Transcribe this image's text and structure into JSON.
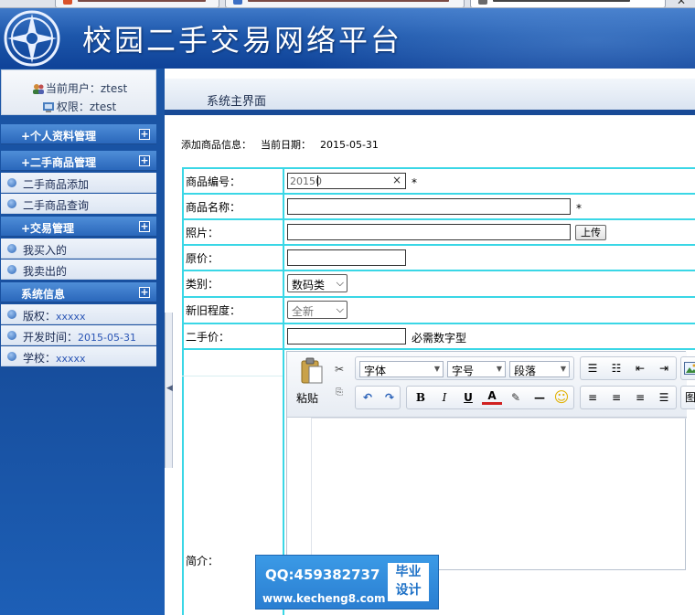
{
  "banner": {
    "title": "校园二手交易网络平台"
  },
  "user": {
    "current_user": "当前用户：ztest",
    "role": "权限：ztest"
  },
  "sidebar": {
    "groups": [
      {
        "label": "+个人资料管理",
        "items": []
      },
      {
        "label": "+二手商品管理",
        "items": [
          "二手商品添加",
          "二手商品查询"
        ]
      },
      {
        "label": "+交易管理",
        "items": [
          "我买入的",
          "我卖出的"
        ]
      },
      {
        "label": "系统信息",
        "items": [
          {
            "label": "版权：",
            "value": "xxxxx"
          },
          {
            "label": "开发时间：",
            "value": "2015-05-31"
          },
          {
            "label": "学校：",
            "value": "xxxxx"
          }
        ]
      }
    ],
    "plus_glyph": "+"
  },
  "main": {
    "tab_title": "系统主界面"
  },
  "form": {
    "info_label": "添加商品信息：",
    "date_label": "当前日期：",
    "date_value": "2015-05-31",
    "required_mark": "*",
    "clear_glyph": "×",
    "fields": {
      "code": {
        "label": "商品编号：",
        "value": "20150"
      },
      "name": {
        "label": "商品名称：",
        "value": ""
      },
      "photo": {
        "label": "照片：",
        "value": "",
        "button": "上传"
      },
      "original_price": {
        "label": "原价：",
        "value": ""
      },
      "category": {
        "label": "类别：",
        "value": "数码类"
      },
      "condition": {
        "label": "新旧程度：",
        "value": "全新"
      },
      "price": {
        "label": "二手价：",
        "value": "",
        "hint": "必需数字型"
      },
      "intro": {
        "label": "简介："
      }
    }
  },
  "editor": {
    "paste_label": "粘贴",
    "font_select": "字体",
    "size_select": "字号",
    "paragraph_select": "段落",
    "bold": "B",
    "italic": "I",
    "underline": "U",
    "font_color": "A",
    "image_label": "图"
  },
  "watermark": {
    "qq": "QQ:459382737",
    "url": "www.kecheng8.com",
    "badge_line1": "毕业",
    "badge_line2": "设计"
  }
}
